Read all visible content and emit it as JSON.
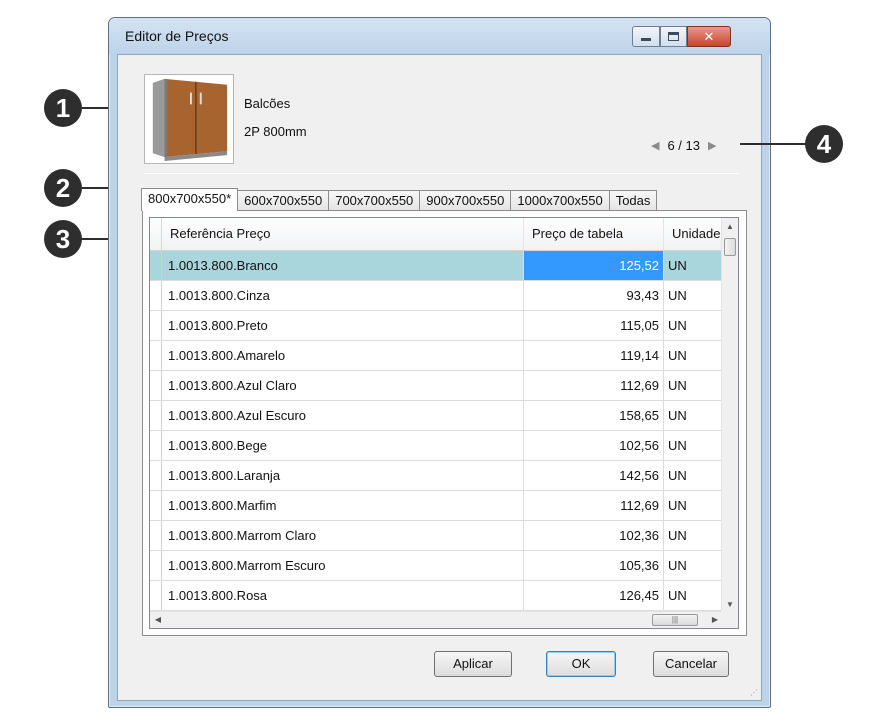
{
  "window": {
    "title": "Editor de Preços"
  },
  "product": {
    "name": "Balcões",
    "description": "2P 800mm",
    "image_icon": "cabinet-thumbnail"
  },
  "navigation": {
    "counter": "6 / 13",
    "prev_icon": "arrow-left-icon",
    "next_icon": "arrow-right-icon"
  },
  "tabs": [
    {
      "label": "800x700x550*",
      "active": true
    },
    {
      "label": "600x700x550"
    },
    {
      "label": "700x700x550"
    },
    {
      "label": "900x700x550"
    },
    {
      "label": "1000x700x550"
    },
    {
      "label": "Todas"
    }
  ],
  "grid": {
    "columns": [
      "Referência Preço",
      "Preço de tabela",
      "Unidade"
    ],
    "rows": [
      {
        "ref": "1.0013.800.Branco",
        "price": "125,52",
        "unit": "UN",
        "selected": true
      },
      {
        "ref": "1.0013.800.Cinza",
        "price": "93,43",
        "unit": "UN"
      },
      {
        "ref": "1.0013.800.Preto",
        "price": "115,05",
        "unit": "UN"
      },
      {
        "ref": "1.0013.800.Amarelo",
        "price": "119,14",
        "unit": "UN"
      },
      {
        "ref": "1.0013.800.Azul Claro",
        "price": "112,69",
        "unit": "UN"
      },
      {
        "ref": "1.0013.800.Azul Escuro",
        "price": "158,65",
        "unit": "UN"
      },
      {
        "ref": "1.0013.800.Bege",
        "price": "102,56",
        "unit": "UN"
      },
      {
        "ref": "1.0013.800.Laranja",
        "price": "142,56",
        "unit": "UN"
      },
      {
        "ref": "1.0013.800.Marfim",
        "price": "112,69",
        "unit": "UN"
      },
      {
        "ref": "1.0013.800.Marrom Claro",
        "price": "102,36",
        "unit": "UN"
      },
      {
        "ref": "1.0013.800.Marrom Escuro",
        "price": "105,36",
        "unit": "UN"
      },
      {
        "ref": "1.0013.800.Rosa",
        "price": "126,45",
        "unit": "UN"
      }
    ]
  },
  "buttons": {
    "apply": "Aplicar",
    "ok": "OK",
    "cancel": "Cancelar"
  },
  "callouts": [
    "1",
    "2",
    "3",
    "4"
  ],
  "colors": {
    "selected_row": "#a9d5dc",
    "selected_cell": "#3399ff",
    "close_button": "#c8452c"
  }
}
